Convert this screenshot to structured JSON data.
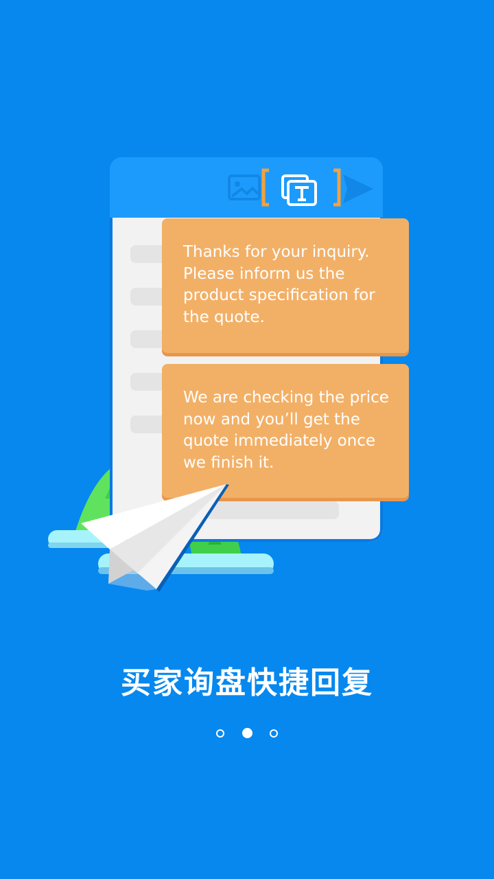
{
  "illustration": {
    "messages": [
      {
        "text": "Thanks for your inquiry. Please inform us the product specification for the quote."
      },
      {
        "text": "We are checking the price now and you’ll get the quote immediately once we finish it."
      }
    ],
    "toolbar_icons": [
      "image-icon",
      "text-box-icon",
      "send-icon"
    ]
  },
  "onboarding": {
    "title": "买家询盘快捷回复",
    "page_indicator": {
      "current": 2,
      "total": 3
    }
  },
  "colors": {
    "background": "#0688ef",
    "bubble": "#f2b067",
    "window_bar": "#1c9bfd"
  }
}
